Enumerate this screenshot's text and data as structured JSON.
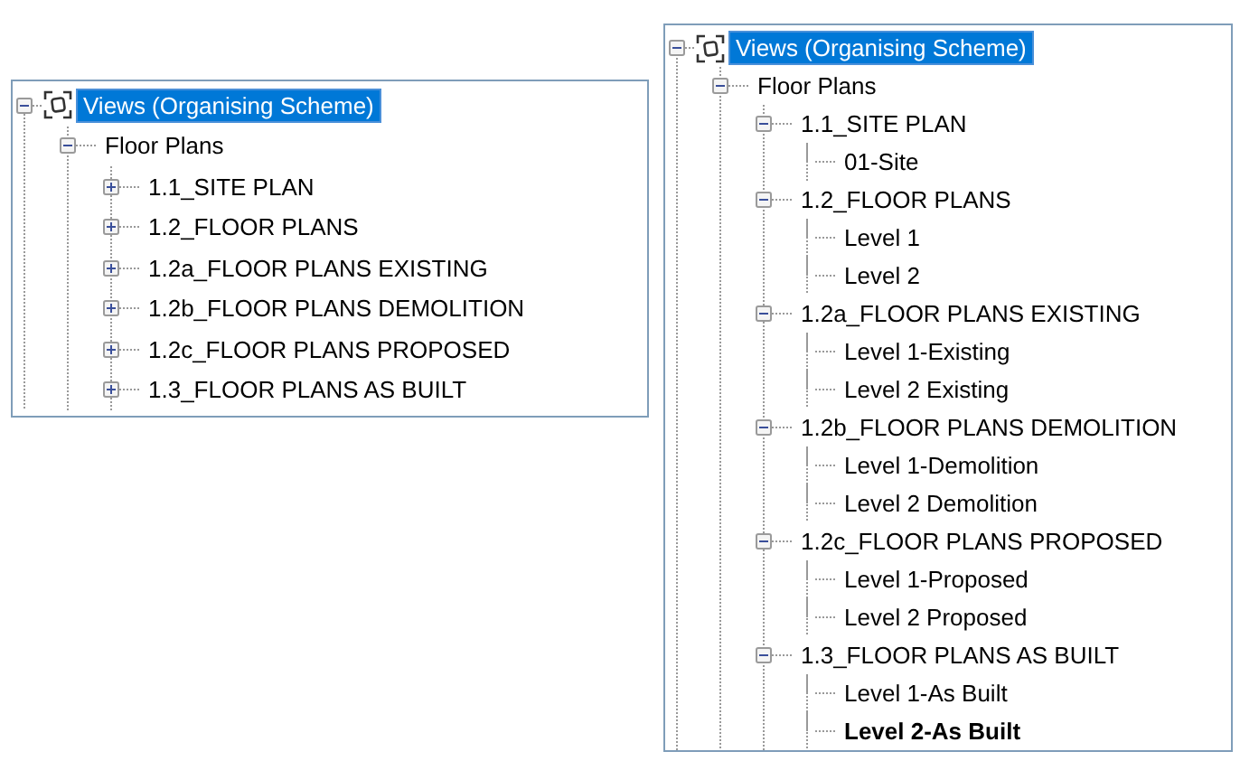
{
  "panels": [
    {
      "root": {
        "label": "Views (Organising Scheme)",
        "selected": true,
        "expanded": true,
        "children": [
          {
            "label": "Floor Plans",
            "selected": false,
            "expanded": true,
            "children": [
              {
                "label": "1.1_SITE PLAN",
                "selected": false,
                "expanded": false
              },
              {
                "label": "1.2_FLOOR PLANS",
                "selected": false,
                "expanded": false
              },
              {
                "label": "1.2a_FLOOR PLANS EXISTING",
                "selected": false,
                "expanded": false
              },
              {
                "label": "1.2b_FLOOR PLANS DEMOLITION",
                "selected": false,
                "expanded": false
              },
              {
                "label": "1.2c_FLOOR PLANS PROPOSED",
                "selected": false,
                "expanded": false
              },
              {
                "label": "1.3_FLOOR PLANS AS BUILT",
                "selected": false,
                "expanded": false
              }
            ]
          }
        ]
      }
    },
    {
      "root": {
        "label": "Views (Organising Scheme)",
        "selected": true,
        "expanded": true,
        "children": [
          {
            "label": "Floor Plans",
            "selected": false,
            "expanded": true,
            "children": [
              {
                "label": "1.1_SITE PLAN",
                "selected": false,
                "expanded": true,
                "children": [
                  {
                    "label": "01-Site",
                    "selected": false,
                    "current": false
                  }
                ]
              },
              {
                "label": "1.2_FLOOR PLANS",
                "selected": false,
                "expanded": true,
                "children": [
                  {
                    "label": "Level 1",
                    "selected": false,
                    "current": false
                  },
                  {
                    "label": "Level 2",
                    "selected": false,
                    "current": false
                  }
                ]
              },
              {
                "label": "1.2a_FLOOR PLANS EXISTING",
                "selected": false,
                "expanded": true,
                "children": [
                  {
                    "label": "Level 1-Existing",
                    "selected": false,
                    "current": false
                  },
                  {
                    "label": "Level 2 Existing",
                    "selected": false,
                    "current": false
                  }
                ]
              },
              {
                "label": "1.2b_FLOOR PLANS DEMOLITION",
                "selected": false,
                "expanded": true,
                "children": [
                  {
                    "label": "Level 1-Demolition",
                    "selected": false,
                    "current": false
                  },
                  {
                    "label": "Level 2 Demolition",
                    "selected": false,
                    "current": false
                  }
                ]
              },
              {
                "label": "1.2c_FLOOR PLANS PROPOSED",
                "selected": false,
                "expanded": true,
                "children": [
                  {
                    "label": "Level 1-Proposed",
                    "selected": false,
                    "current": false
                  },
                  {
                    "label": "Level 2 Proposed",
                    "selected": false,
                    "current": false
                  }
                ]
              },
              {
                "label": "1.3_FLOOR PLANS AS BUILT",
                "selected": false,
                "expanded": true,
                "children": [
                  {
                    "label": "Level 1-As Built",
                    "selected": false,
                    "current": false
                  },
                  {
                    "label": "Level 2-As Built",
                    "selected": false,
                    "current": true
                  }
                ]
              }
            ]
          }
        ]
      }
    }
  ]
}
